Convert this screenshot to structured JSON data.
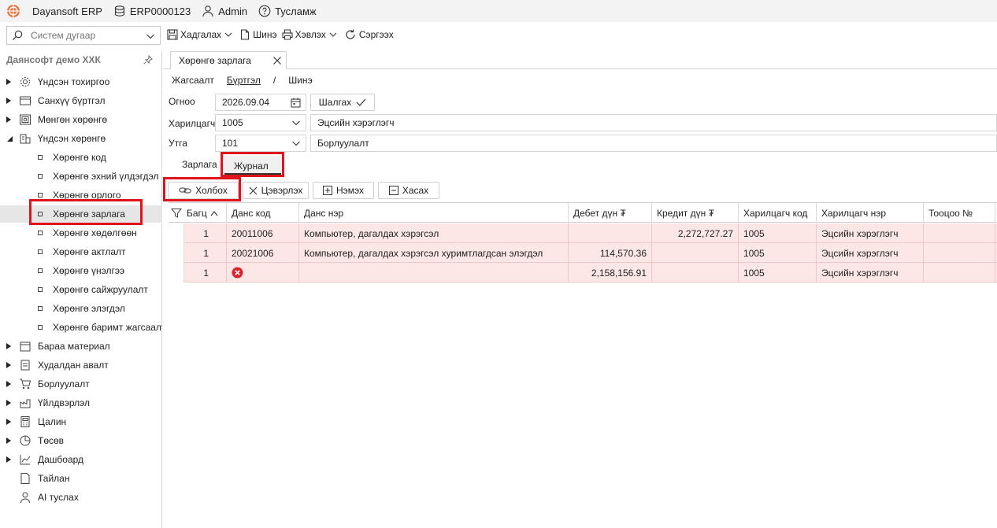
{
  "titlebar": {
    "app_name": "Dayansoft ERP",
    "erp_code": "ERP0000123",
    "user": "Admin",
    "help": "Тусламж"
  },
  "search": {
    "placeholder": "Систем дугаар"
  },
  "toolbar": {
    "save": "Хадгалах",
    "new": "Шинэ",
    "print": "Хэвлэх",
    "refresh": "Сэргээх"
  },
  "sidebar": {
    "company": "Даянсофт демо ХХК",
    "groups": [
      {
        "label": "Үндсэн тохиргоо",
        "icon": "gear-icon"
      },
      {
        "label": "Санхүү бүртгэл",
        "icon": "ledger-icon"
      },
      {
        "label": "Мөнгөн хөрөнгө",
        "icon": "money-icon"
      },
      {
        "label": "Үндсэн хөрөнгө",
        "icon": "building-icon"
      },
      {
        "label": "Бараа материал",
        "icon": "box-icon"
      },
      {
        "label": "Худалдан авалт",
        "icon": "purchase-icon"
      },
      {
        "label": "Борлуулалт",
        "icon": "cart-icon"
      },
      {
        "label": "Үйлдвэрлэл",
        "icon": "factory-icon"
      },
      {
        "label": "Цалин",
        "icon": "calculator-icon"
      },
      {
        "label": "Төсөв",
        "icon": "pie-chart-icon"
      },
      {
        "label": "Дашбоард",
        "icon": "dashboard-icon"
      },
      {
        "label": "Тайлан",
        "icon": "report-icon"
      },
      {
        "label": "AI туслах",
        "icon": "person-icon"
      }
    ],
    "children": [
      "Хөрөнгө код",
      "Хөрөнгө эхний үлдэгдэл",
      "Хөрөнгө орлого",
      "Хөрөнгө зарлага",
      "Хөрөнгө хөдөлгөөн",
      "Хөрөнгө актлалт",
      "Хөрөнгө үнэлгээ",
      "Хөрөнгө сайжруулалт",
      "Хөрөнгө элэгдэл",
      "Хөрөнгө баримт жагсаалт"
    ]
  },
  "doc_tab": {
    "title": "Хөрөнгө зарлага"
  },
  "breadcrumb": {
    "list": "Жагсаалт",
    "register": "Бүртгэл",
    "sep": "/",
    "new": "Шинэ"
  },
  "form": {
    "date_label": "Огноо",
    "date_value": "2026.09.04",
    "check_button": "Шалгах",
    "customer_label": "Харилцагч",
    "customer_code": "1005",
    "customer_name": "Эцсийн хэрэглэгч",
    "type_label": "Утга",
    "type_code": "101",
    "type_name": "Борлуулалт"
  },
  "subtabs": {
    "expense": "Зарлага",
    "journal": "Журнал"
  },
  "actions": {
    "link": "Холбох",
    "clear": "Цэвэрлэх",
    "add": "Нэмэх",
    "delete": "Хасах"
  },
  "grid": {
    "columns": [
      "Багц",
      "Данс код",
      "Данс нэр",
      "Дебет дүн ₮",
      "Кредит дүн ₮",
      "Харилцагч код",
      "Харилцагч нэр",
      "Тооцоо №"
    ],
    "rows": [
      {
        "batch": "1",
        "account_code": "20011006",
        "account_name": "Компьютер, дагалдах хэрэгсэл",
        "debit": "",
        "credit": "2,272,727.27",
        "partner_code": "1005",
        "partner_name": "Эцсийн хэрэглэгч",
        "settlement": ""
      },
      {
        "batch": "1",
        "account_code": "20021006",
        "account_name": "Компьютер, дагалдах хэрэгсэл хуримтлагдсан элэгдэл",
        "debit": "114,570.36",
        "credit": "",
        "partner_code": "1005",
        "partner_name": "Эцсийн хэрэглэгч",
        "settlement": ""
      },
      {
        "batch": "1",
        "account_code": "",
        "account_name": "",
        "debit": "2,158,156.91",
        "credit": "",
        "partner_code": "1005",
        "partner_name": "Эцсийн хэрэглэгч",
        "settlement": "",
        "error": true
      }
    ]
  },
  "colors": {
    "row_error_bg": "#fde6e6",
    "highlight": "#e0121c",
    "logo": "#e8733a"
  }
}
